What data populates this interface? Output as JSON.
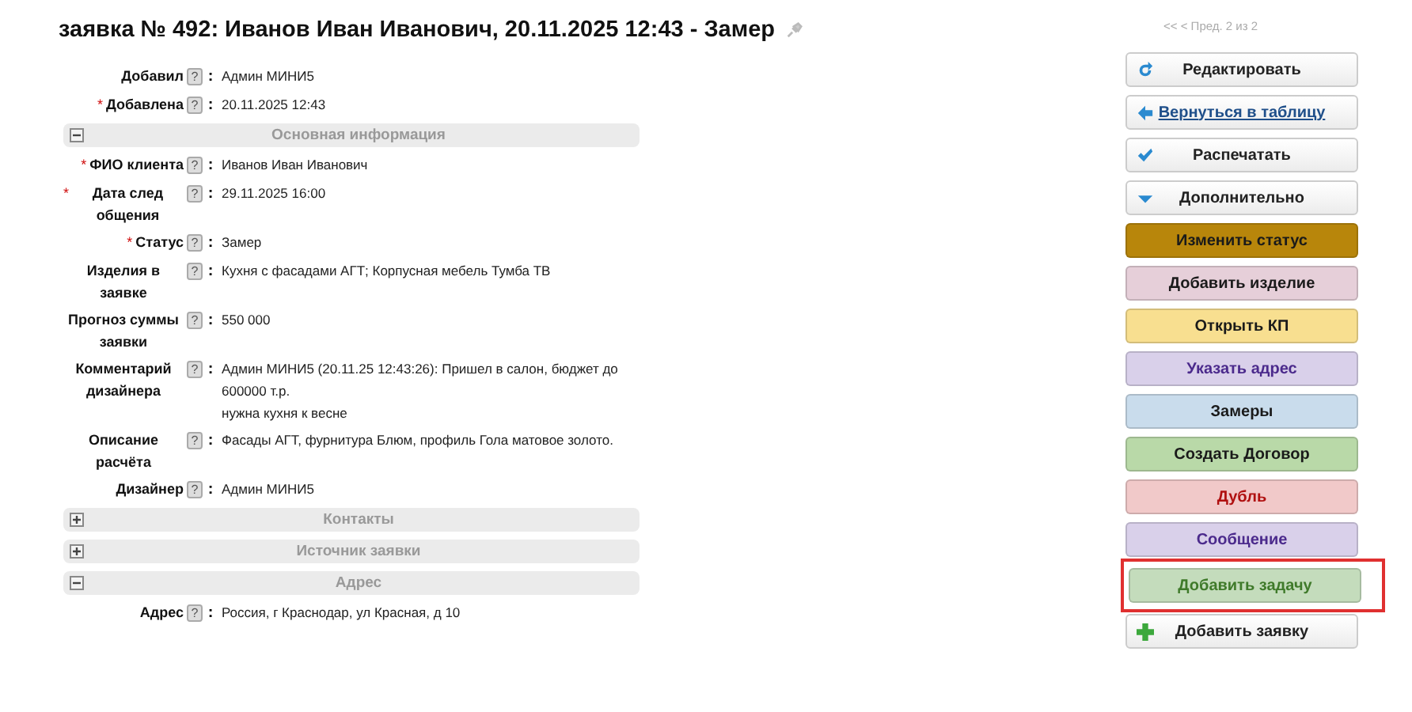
{
  "title": "заявка № 492: Иванов Иван Иванович, 20.11.2025 12:43 - Замер",
  "pager": "<< < Пред. 2 из 2",
  "form": [
    {
      "kind": "field",
      "label": "Добавил",
      "help": "?",
      "separator": ":",
      "value": [
        "Админ МИНИ5"
      ]
    },
    {
      "kind": "field",
      "label": "Добавлена",
      "required_mark": "*",
      "help": "?",
      "separator": ":",
      "value": [
        "20.11.2025 12:43"
      ]
    },
    {
      "kind": "section",
      "title": "Основная информация",
      "expanded": true
    },
    {
      "kind": "field",
      "label": "ФИО клиента",
      "required_mark": "*",
      "help": "?",
      "separator": ":",
      "value": [
        "Иванов Иван Иванович"
      ]
    },
    {
      "kind": "field",
      "label": "Дата след общения",
      "required_mark": "*",
      "help": "?",
      "separator": ":",
      "value": [
        "29.11.2025 16:00"
      ]
    },
    {
      "kind": "field",
      "label": "Статус",
      "required_mark": "*",
      "help": "?",
      "separator": ":",
      "value": [
        "Замер"
      ]
    },
    {
      "kind": "field",
      "label": "Изделия в заявке",
      "help": "?",
      "separator": ":",
      "value": [
        "Кухня с фасадами АГТ; Корпусная мебель Тумба ТВ"
      ]
    },
    {
      "kind": "field",
      "label": "Прогноз суммы заявки",
      "help": "?",
      "separator": ":",
      "value": [
        "550 000"
      ]
    },
    {
      "kind": "field",
      "label": "Комментарий дизайнера",
      "help": "?",
      "separator": ":",
      "value": [
        "Админ МИНИ5 (20.11.25 12:43:26): Пришел в салон, бюджет до 600000 т.р.",
        "нужна кухня к весне"
      ]
    },
    {
      "kind": "field",
      "label": "Описание расчёта",
      "help": "?",
      "separator": ":",
      "value": [
        "Фасады АГТ, фурнитура Блюм, профиль Гола матовое золото."
      ]
    },
    {
      "kind": "field",
      "label": "Дизайнер",
      "help": "?",
      "separator": ":",
      "value": [
        "Админ МИНИ5"
      ]
    },
    {
      "kind": "section",
      "title": "Контакты",
      "expanded": false
    },
    {
      "kind": "section",
      "title": "Источник заявки",
      "expanded": false
    },
    {
      "kind": "section",
      "title": "Адрес",
      "expanded": true
    },
    {
      "kind": "field",
      "label": "Адрес",
      "help": "?",
      "separator": ":",
      "value": [
        "Россия, г Краснодар, ул Красная, д 10"
      ]
    }
  ],
  "actions": [
    {
      "kind": "refresh",
      "label": "Редактировать",
      "highlighted": false
    },
    {
      "kind": "back",
      "label": "Вернуться в таблицу",
      "highlighted": false
    },
    {
      "kind": "check",
      "label": "Распечатать",
      "highlighted": false
    },
    {
      "kind": "dropdown",
      "label": "Дополнительно",
      "highlighted": false
    },
    {
      "kind": "tinted",
      "label": "Изменить статус",
      "color": "#b8860b",
      "highlighted": false
    },
    {
      "kind": "tinted",
      "label": "Добавить изделие",
      "color": "#e6cfd9",
      "highlighted": false
    },
    {
      "kind": "tinted",
      "label": "Открыть КП",
      "color": "#f8df90",
      "highlighted": false
    },
    {
      "kind": "violet",
      "label": "Указать адрес",
      "color": "#d9d0ea",
      "highlighted": false
    },
    {
      "kind": "tinted",
      "label": "Замеры",
      "color": "#c9dcec",
      "highlighted": false
    },
    {
      "kind": "tinted",
      "label": "Создать Договор",
      "color": "#b9d9a8",
      "highlighted": false
    },
    {
      "kind": "alert",
      "label": "Дубль",
      "color": "#f1c9c9",
      "highlighted": false
    },
    {
      "kind": "violet",
      "label": "Сообщение",
      "color": "#d9d0ea",
      "highlighted": false
    },
    {
      "kind": "success",
      "label": "Добавить задачу",
      "color": "#c4dcbc",
      "highlighted": true
    },
    {
      "kind": "add",
      "label": "Добавить заявку",
      "highlighted": false
    }
  ]
}
